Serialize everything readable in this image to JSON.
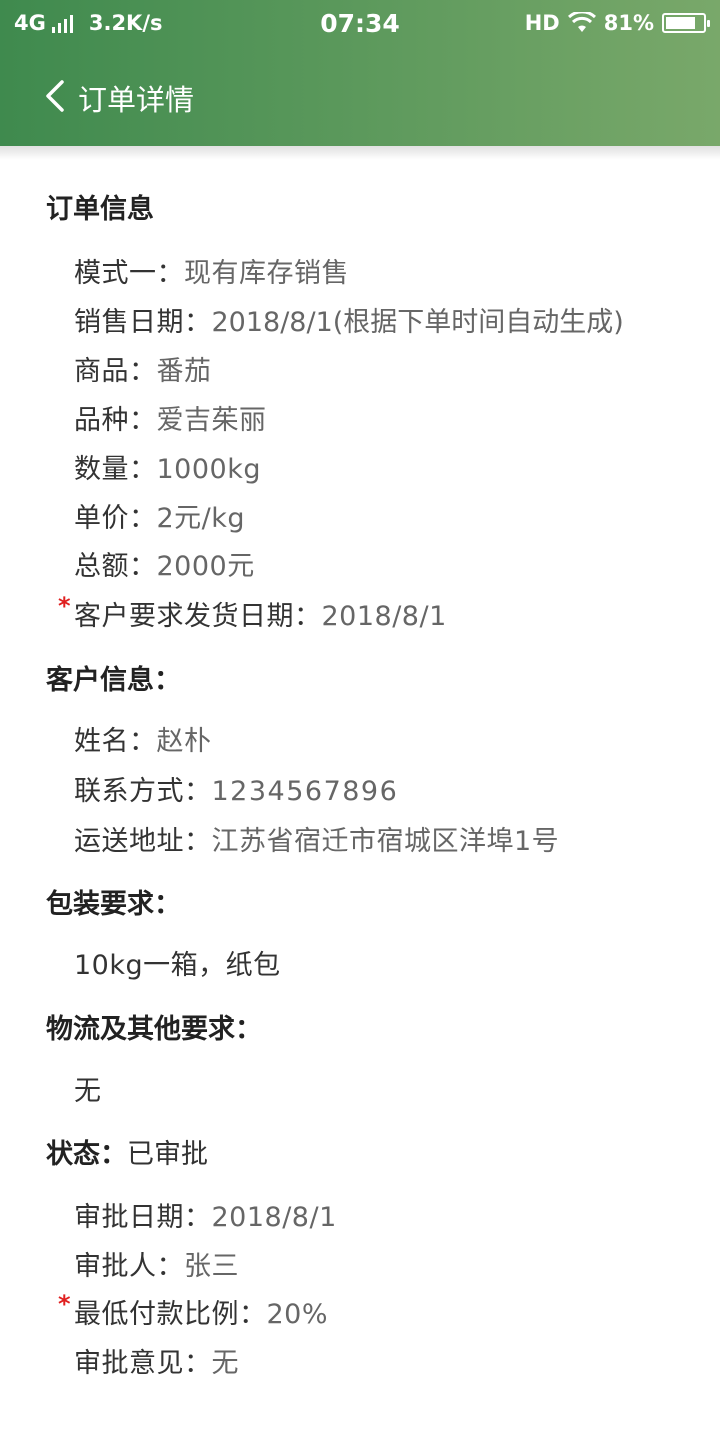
{
  "status_bar": {
    "network": "4G",
    "speed": "3.2K/s",
    "time": "07:34",
    "hd": "HD",
    "battery_text": "81%",
    "battery_level": 0.81
  },
  "header": {
    "title": "订单详情",
    "back_icon": "chevron-left-icon",
    "colors": {
      "start": "#3f8a4e",
      "end": "#79a86a"
    }
  },
  "order_info": {
    "heading": "订单信息",
    "mode_label": "模式一：",
    "mode_value": "现有库存销售",
    "date_label": "销售日期：",
    "date_value": "2018/8/1(根据下单时间自动生成)",
    "product_label": "商品：",
    "product_value": "番茄",
    "variety_label": "品种：",
    "variety_value": "爱吉茱丽",
    "qty_label": "数量：",
    "qty_value": "1000kg",
    "price_label": "单价：",
    "price_value": "2元/kg",
    "total_label": "总额：",
    "total_value": "2000元",
    "ship_req_mark": "*",
    "ship_req_label": "客户要求发货日期：",
    "ship_req_value": "2018/8/1"
  },
  "customer_info": {
    "heading": "客户信息：",
    "name_label": "姓名：",
    "name_value": "赵朴",
    "contact_label": "联系方式：",
    "contact_value": "1234567896",
    "address_label": "运送地址：",
    "address_value": "江苏省宿迁市宿城区洋埠1号"
  },
  "packaging": {
    "heading": "包装要求：",
    "value": "10kg一箱，纸包"
  },
  "logistics": {
    "heading": "物流及其他要求：",
    "value": "无"
  },
  "approval": {
    "heading": "状态：",
    "status_value": "已审批",
    "date_label": "审批日期：",
    "date_value": "2018/8/1",
    "approver_label": "审批人：",
    "approver_value": "张三",
    "min_pay_mark": "*",
    "min_pay_label": "最低付款比例：",
    "min_pay_value": "20%",
    "opinion_label": "审批意见：",
    "opinion_value": "无"
  },
  "colors": {
    "required_mark": "#e02020"
  }
}
